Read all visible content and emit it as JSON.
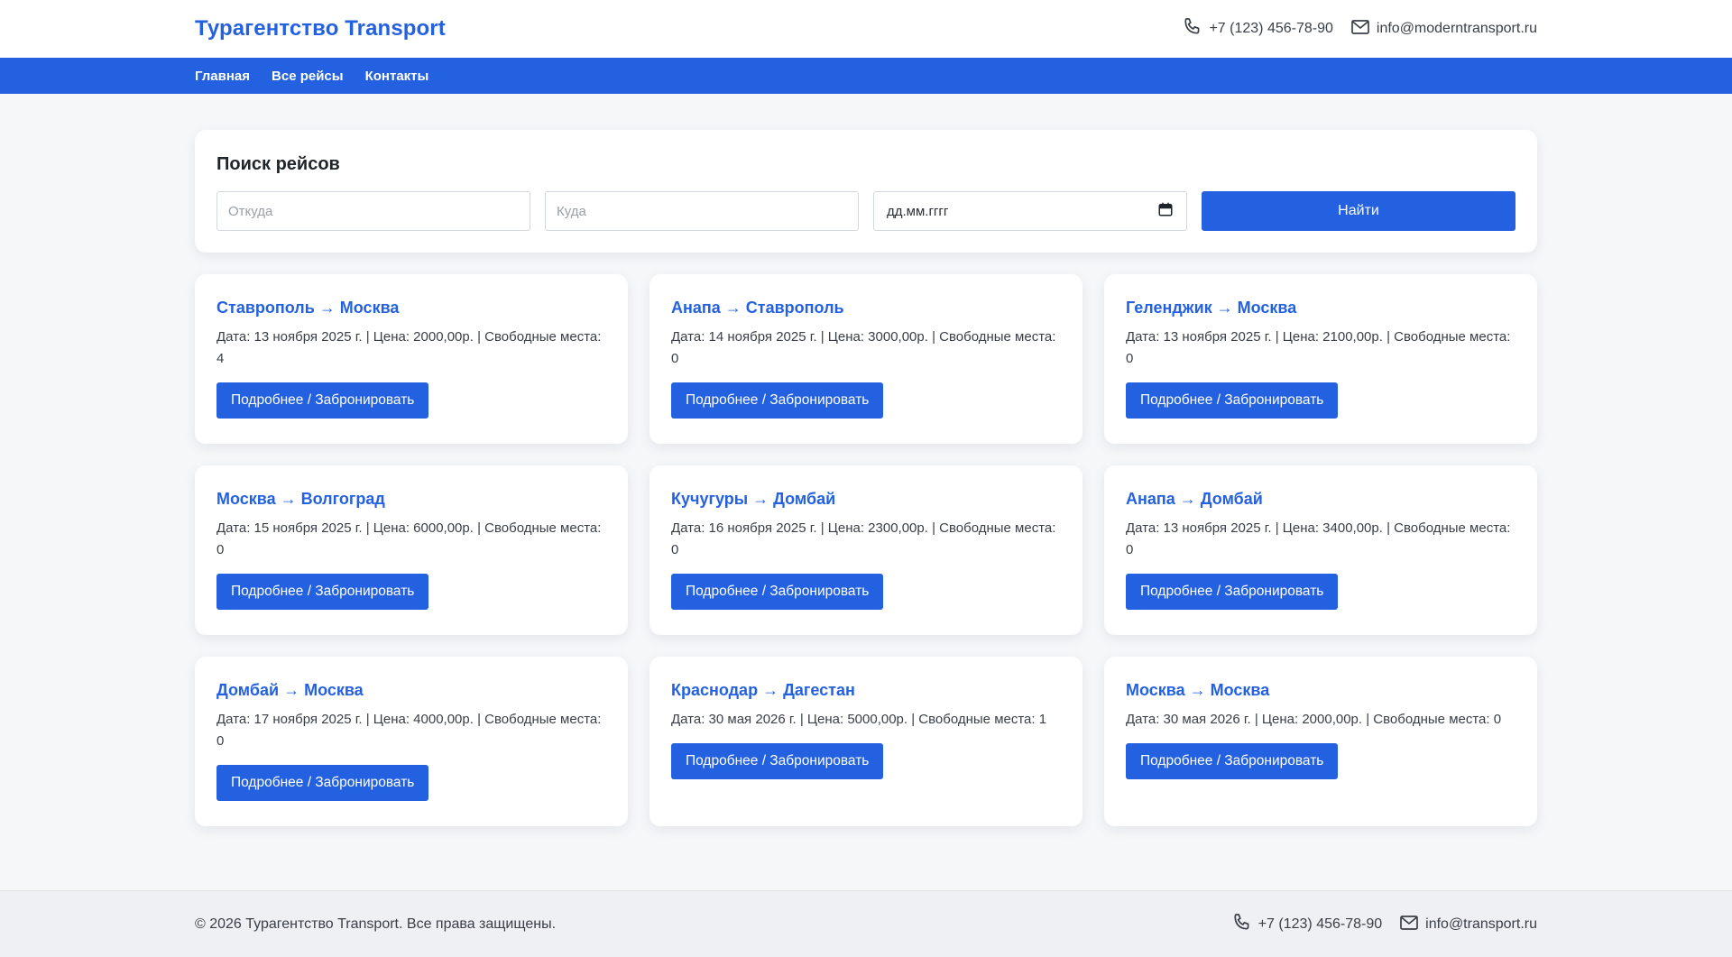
{
  "header": {
    "brand": "Турагентство Transport",
    "phone": "+7 (123) 456-78-90",
    "email": "info@moderntransport.ru"
  },
  "nav": {
    "items": [
      {
        "label": "Главная"
      },
      {
        "label": "Все рейсы"
      },
      {
        "label": "Контакты"
      }
    ]
  },
  "search": {
    "title": "Поиск рейсов",
    "from_placeholder": "Откуда",
    "to_placeholder": "Куда",
    "date_placeholder": "дд.мм.гггг",
    "submit_label": "Найти"
  },
  "trips": [
    {
      "route": "Ставрополь → Москва",
      "info": "Дата: 13 ноября 2025 г. | Цена: 2000,00р. | Свободные места: 4",
      "button": "Подробнее / Забронировать"
    },
    {
      "route": "Анапа → Ставрополь",
      "info": "Дата: 14 ноября 2025 г. | Цена: 3000,00р. | Свободные места: 0",
      "button": "Подробнее / Забронировать"
    },
    {
      "route": "Геленджик → Москва",
      "info": "Дата: 13 ноября 2025 г. | Цена: 2100,00р. | Свободные места: 0",
      "button": "Подробнее / Забронировать"
    },
    {
      "route": "Москва → Волгоград",
      "info": "Дата: 15 ноября 2025 г. | Цена: 6000,00р. | Свободные места: 0",
      "button": "Подробнее / Забронировать"
    },
    {
      "route": "Кучугуры → Домбай",
      "info": "Дата: 16 ноября 2025 г. | Цена: 2300,00р. | Свободные места: 0",
      "button": "Подробнее / Забронировать"
    },
    {
      "route": "Анапа → Домбай",
      "info": "Дата: 13 ноября 2025 г. | Цена: 3400,00р. | Свободные места: 0",
      "button": "Подробнее / Забронировать"
    },
    {
      "route": "Домбай → Москва",
      "info": "Дата: 17 ноября 2025 г. | Цена: 4000,00р. | Свободные места: 0",
      "button": "Подробнее / Забронировать"
    },
    {
      "route": "Краснодар → Дагестан",
      "info": "Дата: 30 мая 2026 г. | Цена: 5000,00р. | Свободные места: 1",
      "button": "Подробнее / Забронировать"
    },
    {
      "route": "Москва → Москва",
      "info": "Дата: 30 мая 2026 г. | Цена: 2000,00р. | Свободные места: 0",
      "button": "Подробнее / Забронировать"
    }
  ],
  "footer": {
    "copyright": "© 2026 Турагентство Transport. Все права защищены.",
    "phone": "+7 (123) 456-78-90",
    "email": "info@transport.ru"
  },
  "colors": {
    "accent": "#2461e0",
    "background": "#f6f7f9",
    "footer_bg": "#eef0f3"
  },
  "icons": {
    "phone": "phone-icon",
    "email": "mail-icon",
    "calendar": "calendar-icon"
  }
}
